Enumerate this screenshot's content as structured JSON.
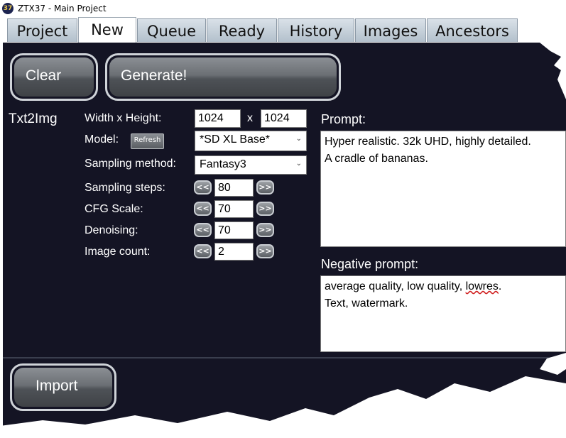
{
  "window": {
    "title": "ZTX37 - Main Project",
    "icon": "app-logo-icon"
  },
  "tabs": [
    {
      "label": "Project"
    },
    {
      "label": "New"
    },
    {
      "label": "Queue"
    },
    {
      "label": "Ready"
    },
    {
      "label": "History"
    },
    {
      "label": "Images"
    },
    {
      "label": "Ancestors"
    }
  ],
  "active_tab": "New",
  "toolbar": {
    "clear_label": "Clear",
    "generate_label": "Generate!"
  },
  "section": {
    "label": "Txt2Img"
  },
  "form": {
    "size_label": "Width x Height:",
    "width": "1024",
    "x_label": "x",
    "height": "1024",
    "model_label": "Model:",
    "refresh_label": "Refresh",
    "model_value": "*SD XL Base*",
    "sampling_label": "Sampling method:",
    "sampling_value": "Fantasy3",
    "steps_label": "Sampling steps:",
    "steps_value": "80",
    "cfg_label": "CFG Scale:",
    "cfg_value": "70",
    "denoise_label": "Denoising:",
    "denoise_value": "70",
    "count_label": "Image count:",
    "count_value": "2",
    "dec_label": "<<",
    "inc_label": ">>"
  },
  "prompt": {
    "label": "Prompt:",
    "line1": "Hyper realistic. 32k UHD, highly detailed.",
    "line2": "A cradle of bananas."
  },
  "negative": {
    "label": "Negative prompt:",
    "line1_a": "average quality, low quality, ",
    "line1_misspelled": "lowres",
    "line1_b": ".",
    "line2": "Text, watermark."
  },
  "footer": {
    "import_label": "Import"
  },
  "colors": {
    "panel": "#141424",
    "accent_tab": "#b3c0cc"
  }
}
